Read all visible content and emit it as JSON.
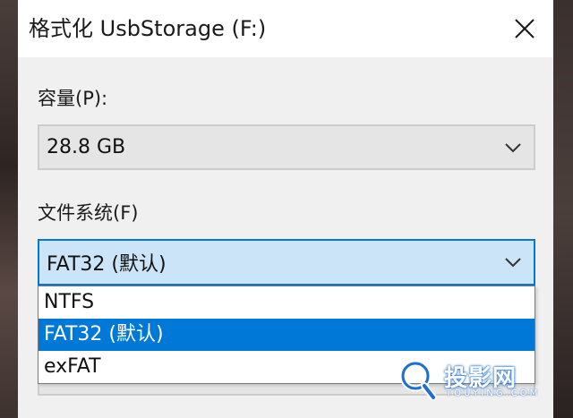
{
  "window": {
    "title": "格式化 UsbStorage (F:)",
    "close_icon": "close-icon"
  },
  "capacity": {
    "label": "容量(P):",
    "value": "28.8 GB"
  },
  "file_system": {
    "label": "文件系统(F)",
    "value": "FAT32 (默认)",
    "options": [
      "NTFS",
      "FAT32 (默认)",
      "exFAT"
    ],
    "selected_index": 1
  },
  "watermark": {
    "text": "投影网",
    "sub": "TOUYING.COM"
  },
  "colors": {
    "accent": "#0078d7",
    "selected_field_bg": "#cce4f7",
    "dialog_bg": "#f0f0f0"
  }
}
